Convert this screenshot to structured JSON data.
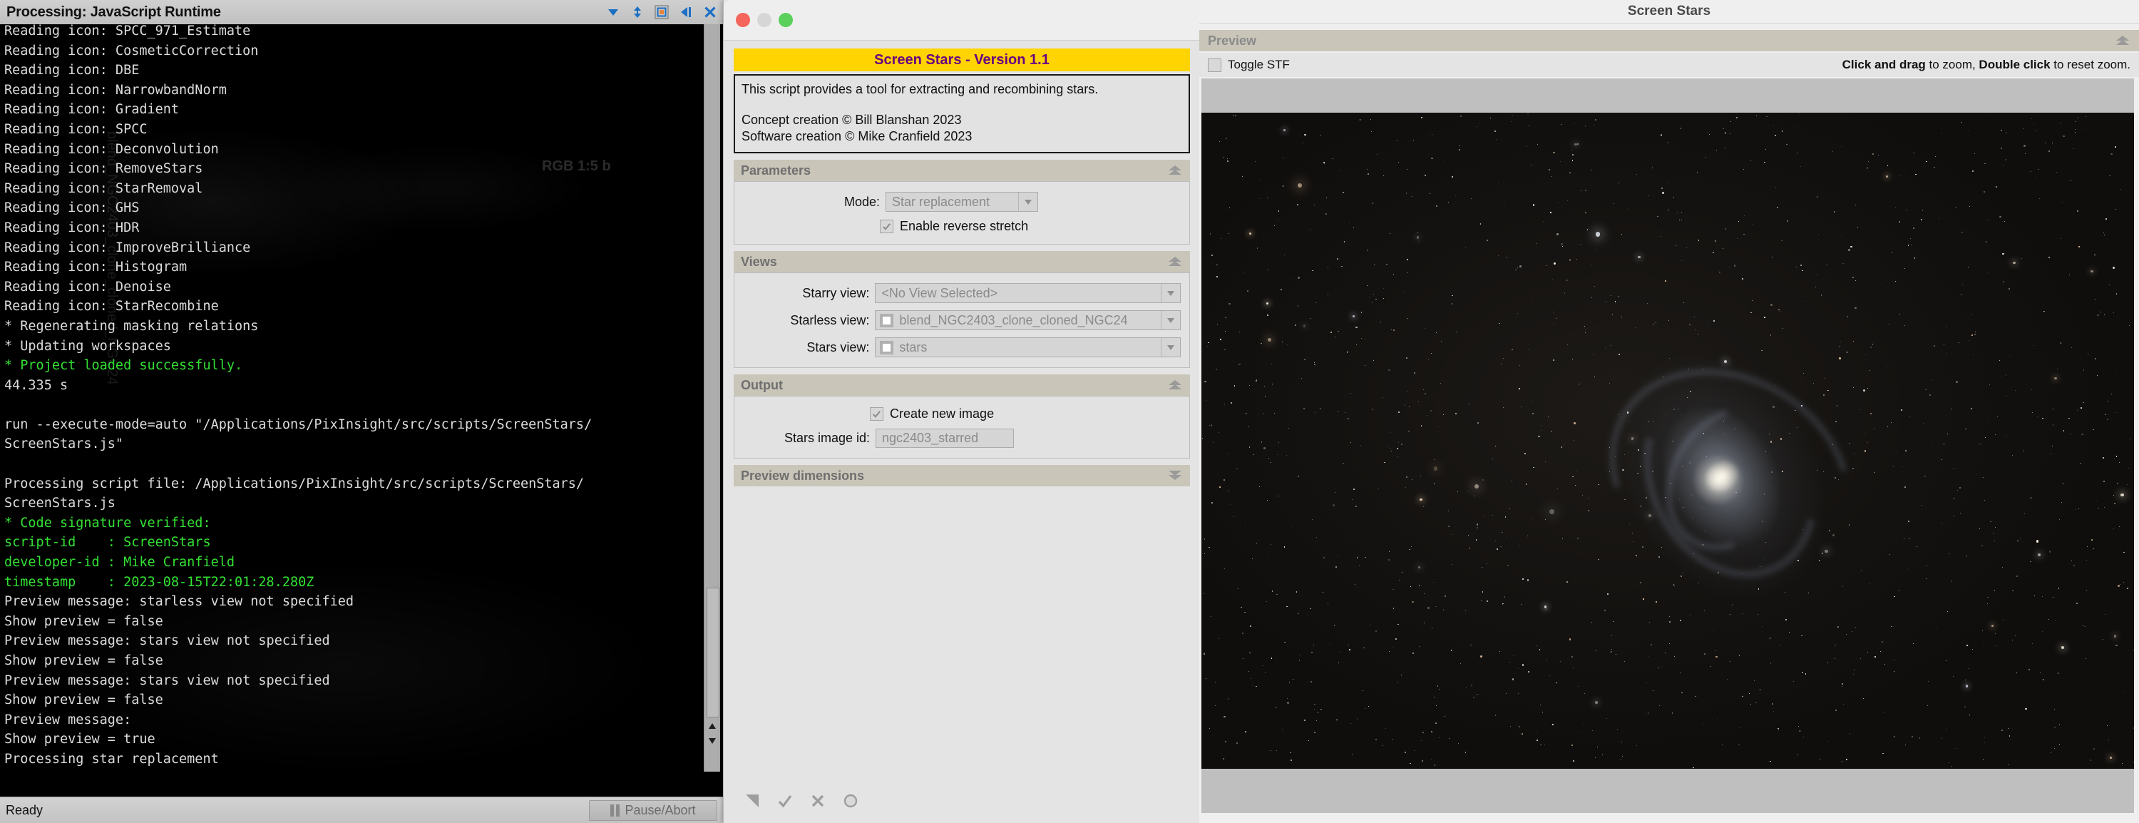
{
  "console": {
    "title": "Processing: JavaScript Runtime",
    "title_icons": [
      "chevron-down-icon",
      "resize-vertical-icon",
      "maximize-icon",
      "collapse-left-icon",
      "close-icon"
    ],
    "watermark": "blend_NGC2403_clone_cloned_NGC24",
    "rgb_tag": "RGB 1:5 b",
    "log_lines": [
      {
        "text": "Reading icon: SPCC_971_Estimate",
        "color": "white"
      },
      {
        "text": "Reading icon: CosmeticCorrection",
        "color": "white"
      },
      {
        "text": "Reading icon: DBE",
        "color": "white"
      },
      {
        "text": "Reading icon: NarrowbandNorm",
        "color": "white"
      },
      {
        "text": "Reading icon: Gradient",
        "color": "white"
      },
      {
        "text": "Reading icon: SPCC",
        "color": "white"
      },
      {
        "text": "Reading icon: Deconvolution",
        "color": "white"
      },
      {
        "text": "Reading icon: RemoveStars",
        "color": "white"
      },
      {
        "text": "Reading icon: StarRemoval",
        "color": "white"
      },
      {
        "text": "Reading icon: GHS",
        "color": "white"
      },
      {
        "text": "Reading icon: HDR",
        "color": "white"
      },
      {
        "text": "Reading icon: ImproveBrilliance",
        "color": "white"
      },
      {
        "text": "Reading icon: Histogram",
        "color": "white"
      },
      {
        "text": "Reading icon: Denoise",
        "color": "white"
      },
      {
        "text": "Reading icon: StarRecombine",
        "color": "white"
      },
      {
        "text": "* Regenerating masking relations",
        "color": "white"
      },
      {
        "text": "* Updating workspaces",
        "color": "white"
      },
      {
        "text": "* Project loaded successfully.",
        "color": "green"
      },
      {
        "text": "44.335 s",
        "color": "white"
      },
      {
        "text": "",
        "color": "white"
      },
      {
        "text": "run --execute-mode=auto \"/Applications/PixInsight/src/scripts/ScreenStars/",
        "color": "white"
      },
      {
        "text": "ScreenStars.js\"",
        "color": "white"
      },
      {
        "text": "",
        "color": "white"
      },
      {
        "text": "Processing script file: /Applications/PixInsight/src/scripts/ScreenStars/",
        "color": "white"
      },
      {
        "text": "ScreenStars.js",
        "color": "white"
      },
      {
        "text": "* Code signature verified:",
        "color": "green"
      },
      {
        "text": "script-id    : ScreenStars",
        "color": "green"
      },
      {
        "text": "developer-id : Mike Cranfield",
        "color": "green"
      },
      {
        "text": "timestamp    : 2023-08-15T22:01:28.280Z",
        "color": "green"
      },
      {
        "text": "Preview message: starless view not specified",
        "color": "white"
      },
      {
        "text": "Show preview = false",
        "color": "white"
      },
      {
        "text": "Preview message: stars view not specified",
        "color": "white"
      },
      {
        "text": "Show preview = false",
        "color": "white"
      },
      {
        "text": "Preview message: stars view not specified",
        "color": "white"
      },
      {
        "text": "Show preview = false",
        "color": "white"
      },
      {
        "text": "Preview message:",
        "color": "white"
      },
      {
        "text": "Show preview = true",
        "color": "white"
      },
      {
        "text": "Processing star replacement",
        "color": "white"
      }
    ],
    "status_text": "Ready",
    "pause_abort_label": "Pause/Abort"
  },
  "dialog": {
    "window_controls": [
      "close",
      "minimize",
      "maximize"
    ],
    "banner": "Screen Stars - Version 1.1",
    "description": {
      "line1": "This script provides a tool for extracting and recombining stars.",
      "line2": "Concept creation © Bill Blanshan 2023",
      "line3": "Software creation © Mike Cranfield 2023"
    },
    "sections": {
      "parameters": {
        "title": "Parameters",
        "collapsed": false,
        "mode_label": "Mode:",
        "mode_value": "Star replacement",
        "reverse_stretch_label": "Enable reverse stretch",
        "reverse_stretch_checked": true
      },
      "views": {
        "title": "Views",
        "collapsed": false,
        "starry_label": "Starry view:",
        "starry_value": "<No View Selected>",
        "starless_label": "Starless view:",
        "starless_value": "blend_NGC2403_clone_cloned_NGC24",
        "stars_label": "Stars view:",
        "stars_value": "stars"
      },
      "output": {
        "title": "Output",
        "collapsed": false,
        "create_new_label": "Create new image",
        "create_new_checked": true,
        "stars_image_id_label": "Stars image id:",
        "stars_image_id_value": "ngc2403_starred"
      },
      "preview_dimensions": {
        "title": "Preview dimensions",
        "collapsed": true
      }
    },
    "bottom_icons": [
      "new-instance-icon",
      "apply-check-icon",
      "cancel-x-icon",
      "reset-circle-icon"
    ]
  },
  "preview": {
    "window_title": "Screen Stars",
    "section_title": "Preview",
    "collapsed": false,
    "toggle_stf_label": "Toggle STF",
    "toggle_stf_checked": false,
    "hint_bold_1": "Click and drag",
    "hint_plain_1": " to zoom, ",
    "hint_bold_2": "Double click",
    "hint_plain_2": " to reset zoom.",
    "image_subject": "NGC 2403 spiral galaxy starfield"
  },
  "colors": {
    "banner_bg": "#ffd400",
    "banner_text": "#6a0080",
    "section_header_bg": "#c9c5b9",
    "dialog_bg": "#e4e4e4",
    "console_bg": "#000000",
    "console_text": "#dcdcdc",
    "console_green": "#33e033",
    "titlebar_icon_blue": "#1a6fc4",
    "maximize_orange": "#e8843c",
    "traffic_red": "#f5655b",
    "traffic_green": "#5bd15b"
  }
}
